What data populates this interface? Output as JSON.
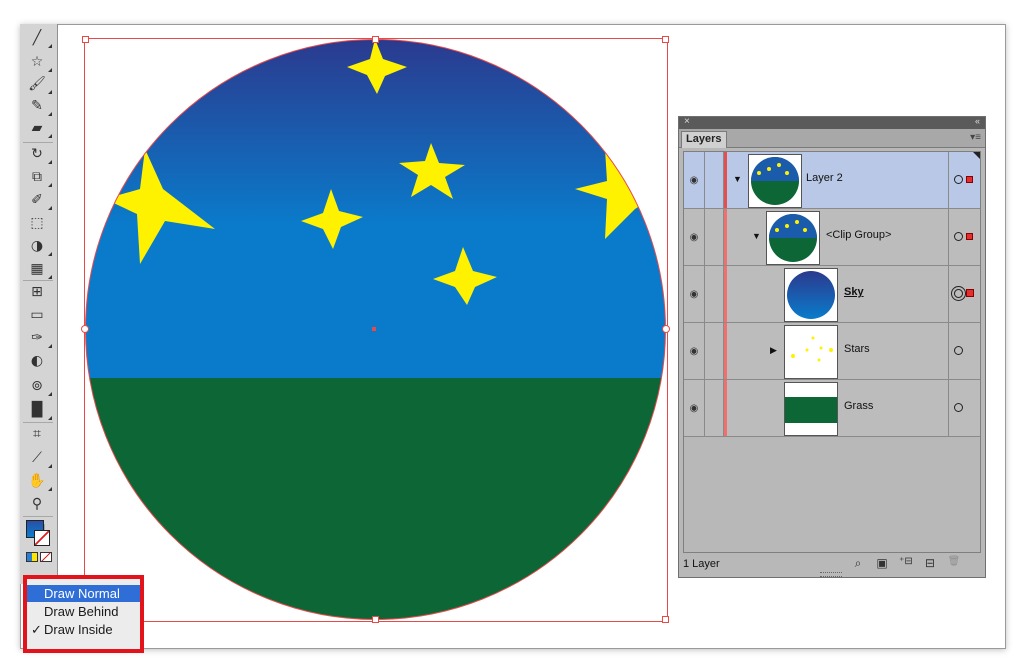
{
  "draw_modes": {
    "items": [
      {
        "label": "Draw Normal",
        "checked": false,
        "highlighted": true
      },
      {
        "label": "Draw Behind",
        "checked": false,
        "highlighted": false
      },
      {
        "label": "Draw Inside",
        "checked": true,
        "highlighted": false
      }
    ],
    "check_glyph": "✓"
  },
  "tools": [
    "line-segment-tool-icon",
    "star-tool-icon",
    "paintbrush-tool-icon",
    "blob-brush-tool-icon",
    "eraser-tool-icon",
    "rotate-tool-icon",
    "scale-tool-icon",
    "warp-tool-icon",
    "free-transform-tool-icon",
    "shape-builder-tool-icon",
    "perspective-grid-tool-icon",
    "mesh-tool-icon",
    "gradient-tool-icon",
    "eyedropper-tool-icon",
    "blend-tool-icon",
    "symbol-sprayer-tool-icon",
    "column-graph-tool-icon",
    "artboard-tool-icon",
    "slice-tool-icon",
    "hand-tool-icon",
    "zoom-tool-icon"
  ],
  "layers_panel": {
    "tab_label": "Layers",
    "close_glyph": "×",
    "collapse_glyph": "«",
    "menu_glyph": "▾≡",
    "footer_count": "1 Layer",
    "rows": [
      {
        "name": "Layer 2",
        "selected": true,
        "has_disclosure": true,
        "expanded": true,
        "target": "circle",
        "selection": "small"
      },
      {
        "name": "<Clip Group>",
        "selected": false,
        "has_disclosure": true,
        "expanded": true,
        "target": "circle",
        "selection": "small"
      },
      {
        "name": "Sky",
        "selected": false,
        "has_disclosure": false,
        "link_style": true,
        "target": "double-circle",
        "selection": "big"
      },
      {
        "name": "Stars",
        "selected": false,
        "has_disclosure": true,
        "expanded": false,
        "target": "circle",
        "selection": "none"
      },
      {
        "name": "Grass",
        "selected": false,
        "has_disclosure": false,
        "target": "circle",
        "selection": "none"
      }
    ],
    "footer_buttons": [
      {
        "icon": "locate-object-icon",
        "glyph": "⌕"
      },
      {
        "icon": "make-clipping-mask-icon",
        "glyph": "▣"
      },
      {
        "icon": "new-sublayer-icon",
        "glyph": "⁺⊟"
      },
      {
        "icon": "new-layer-icon",
        "glyph": "⊟"
      },
      {
        "icon": "delete-layer-icon",
        "glyph": "🗑"
      }
    ]
  },
  "colors": {
    "sky_top": "#2a3a8c",
    "sky_bottom": "#0a78c8",
    "grass": "#0c6635",
    "star": "#fff200",
    "selection": "#e84a4a",
    "popup_border": "#e3131b",
    "popup_highlight": "#2f6ed6"
  }
}
